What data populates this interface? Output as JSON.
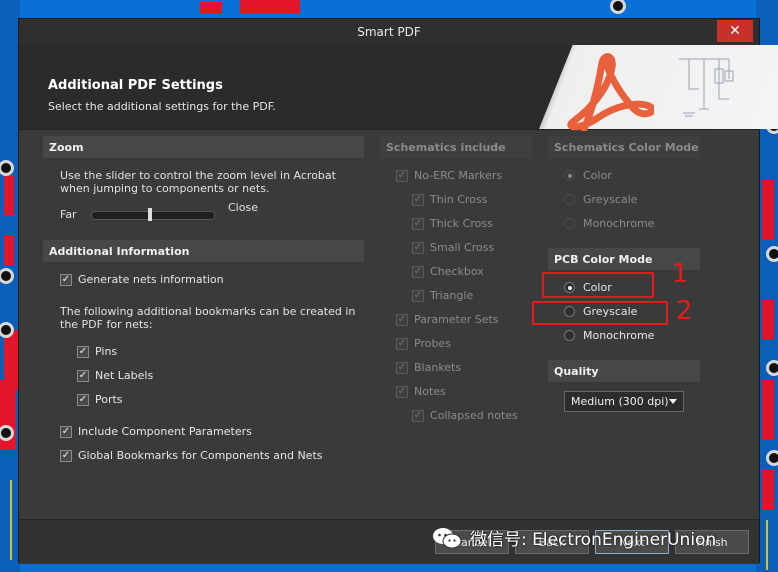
{
  "window": {
    "title": "Smart PDF",
    "close_glyph": "✕"
  },
  "header": {
    "title": "Additional PDF Settings",
    "subtitle": "Select the additional settings for the PDF."
  },
  "zoom": {
    "title": "Zoom",
    "description": "Use the slider to control the zoom level in Acrobat when jumping to components or nets.",
    "far_label": "Far",
    "close_label": "Close",
    "level": 0.48
  },
  "additional_info": {
    "title": "Additional Information",
    "generate_nets": {
      "label": "Generate nets information",
      "checked": true
    },
    "bookmarks_text": "The following additional bookmarks can be created in the PDF for nets:",
    "bookmarks": [
      {
        "label": "Pins",
        "checked": true
      },
      {
        "label": "Net Labels",
        "checked": true
      },
      {
        "label": "Ports",
        "checked": true
      }
    ],
    "include_component_params": {
      "label": "Include Component Parameters",
      "checked": true
    },
    "global_bookmarks": {
      "label": "Global Bookmarks for Components and Nets",
      "checked": true
    }
  },
  "schematics_include": {
    "title": "Schematics include",
    "items": [
      {
        "label": "No-ERC Markers",
        "checked": true
      },
      {
        "label": "Thin Cross",
        "checked": true
      },
      {
        "label": "Thick Cross",
        "checked": true
      },
      {
        "label": "Small Cross",
        "checked": true
      },
      {
        "label": "Checkbox",
        "checked": true
      },
      {
        "label": "Triangle",
        "checked": true
      },
      {
        "label": "Parameter Sets",
        "checked": true
      },
      {
        "label": "Probes",
        "checked": true
      },
      {
        "label": "Blankets",
        "checked": true
      },
      {
        "label": "Notes",
        "checked": true
      },
      {
        "label": "Collapsed notes",
        "checked": true
      }
    ]
  },
  "schematics_color_mode": {
    "title": "Schematics Color Mode",
    "options": [
      "Color",
      "Greyscale",
      "Monochrome"
    ],
    "selected": "Color"
  },
  "pcb_color_mode": {
    "title": "PCB Color Mode",
    "options": [
      "Color",
      "Greyscale",
      "Monochrome"
    ],
    "selected": "Color"
  },
  "quality": {
    "title": "Quality",
    "selected": "Medium (300 dpi)"
  },
  "footer": {
    "cancel": "Cancel",
    "back": "Back",
    "next": "Next",
    "finish": "Finish"
  },
  "annotations": {
    "num1": "1",
    "num2": "2",
    "color": "#e41b1b"
  },
  "watermark": {
    "text": "微信号: ElectronEnginerUnion"
  },
  "colors": {
    "background": "#0a6fd0",
    "dialog": "#3a3a3a",
    "panel_title": "#474747",
    "close_button": "#c8302a",
    "pcb_pad": "#e3152b"
  }
}
